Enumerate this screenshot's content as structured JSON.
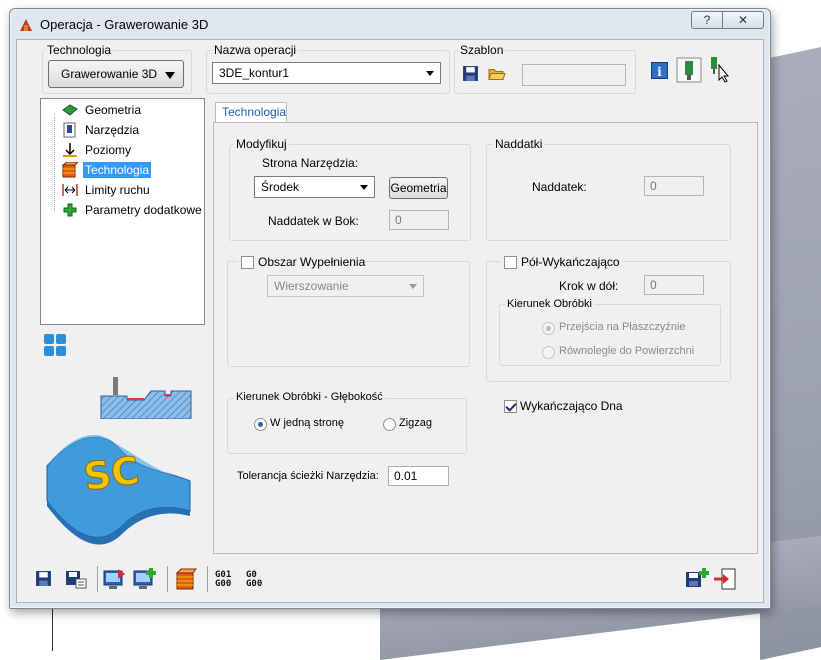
{
  "window": {
    "title": "Operacja - Grawerowanie 3D",
    "help_label": "?",
    "close_label": "✕"
  },
  "technologia": {
    "label": "Technologia",
    "value": "Grawerowanie 3D"
  },
  "nazwa_operacji": {
    "label": "Nazwa operacji",
    "value": "3DE_kontur1"
  },
  "szablon": {
    "label": "Szablon",
    "value": ""
  },
  "tree": {
    "items": [
      {
        "label": "Geometria",
        "icon": "geometry-icon"
      },
      {
        "label": "Narzędzia",
        "icon": "tool-icon"
      },
      {
        "label": "Poziomy",
        "icon": "levels-icon"
      },
      {
        "label": "Technologia",
        "icon": "technology-icon",
        "selected": true
      },
      {
        "label": "Limity ruchu",
        "icon": "motion-limits-icon"
      },
      {
        "label": "Parametry dodatkowe",
        "icon": "add-params-icon"
      }
    ]
  },
  "tab": {
    "label": "Technologia"
  },
  "modyfikuj": {
    "label": "Modyfikuj",
    "strona_label": "Strona Narzędzia:",
    "strona_value": "Środek",
    "geometria_button": "Geometria",
    "naddatek_bok_label": "Naddatek w Bok:",
    "naddatek_bok_value": "0"
  },
  "naddatki": {
    "label": "Naddatki",
    "naddatek_label": "Naddatek:",
    "naddatek_value": "0"
  },
  "obszar": {
    "label": "Obszar Wypełnienia",
    "checked": false,
    "combo_value": "Wierszowanie"
  },
  "polwyk": {
    "label": "Pół-Wykańczająco",
    "checked": false,
    "krok_label": "Krok w dół:",
    "krok_value": "0",
    "kierunek_label": "Kierunek Obróbki",
    "option1": "Przejścia na Płaszczyźnie",
    "option2": "Równolegle do Powierzchni"
  },
  "glebokosc": {
    "label": "Kierunek Obróbki - Głębokość",
    "option1": "W jedną stronę",
    "option2": "Zigzag"
  },
  "wykanczajaco_dna": {
    "label": "Wykańczająco Dna",
    "checked": true
  },
  "tolerancja": {
    "label": "Tolerancja ścieżki Narzędzia:",
    "value": "0.01"
  },
  "toolbar": {
    "gcode1": [
      "G01",
      "G00"
    ],
    "gcode2": [
      "G0",
      "G00"
    ]
  },
  "colors": {
    "selection": "#3399ff",
    "tab_text": "#1e5cb3",
    "accent_blue": "#2b8fd8"
  }
}
